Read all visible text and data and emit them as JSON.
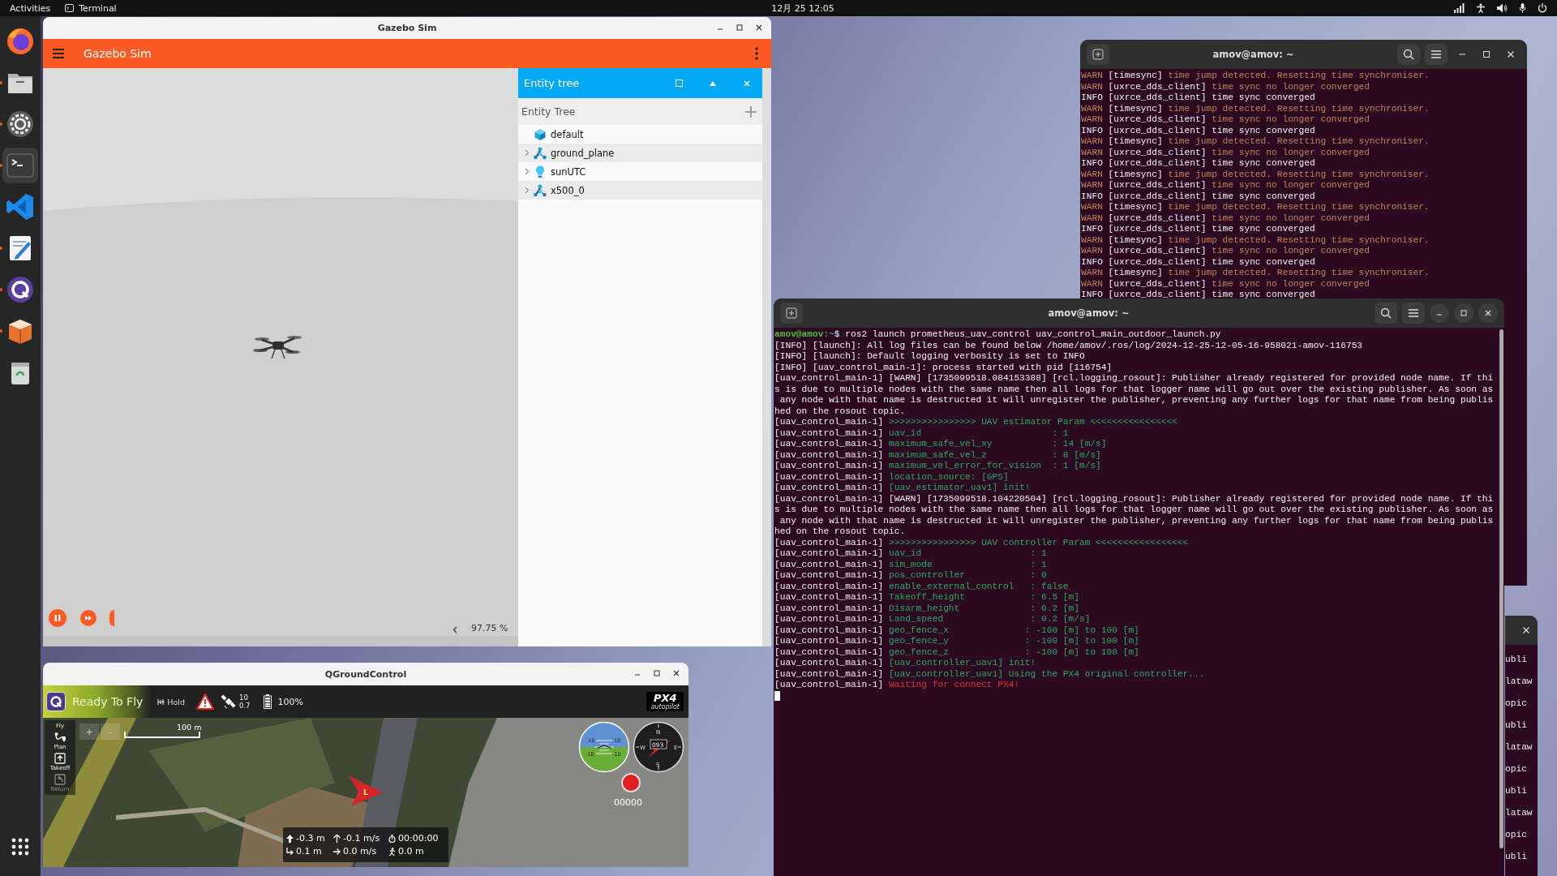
{
  "top_bar": {
    "activities": "Activities",
    "app_name": "Terminal",
    "clock": "12月 25 12:05"
  },
  "dock": {
    "apps": [
      {
        "kind": "firefox",
        "running": false,
        "selected": false
      },
      {
        "kind": "files",
        "running": true,
        "selected": false
      },
      {
        "kind": "settings",
        "running": true,
        "selected": false
      },
      {
        "kind": "terminal",
        "running": true,
        "selected": true
      },
      {
        "kind": "vscode",
        "running": false,
        "selected": false
      },
      {
        "kind": "editor",
        "running": true,
        "selected": false
      },
      {
        "kind": "qgc",
        "running": true,
        "selected": false
      },
      {
        "kind": "installer",
        "running": true,
        "selected": false
      },
      {
        "kind": "trash",
        "running": false,
        "selected": false
      }
    ]
  },
  "gazebo": {
    "title": "Gazebo Sim",
    "header": "Gazebo Sim",
    "paused": false,
    "rtf": "97.75 %",
    "panel": {
      "title": "Entity tree",
      "heading": "Entity Tree",
      "items": [
        {
          "label": "default",
          "kind": "world",
          "expandable": false
        },
        {
          "label": "ground_plane",
          "kind": "model",
          "expandable": true
        },
        {
          "label": "sunUTC",
          "kind": "light",
          "expandable": true
        },
        {
          "label": "x500_0",
          "kind": "model",
          "expandable": true
        }
      ]
    }
  },
  "terminal_back": {
    "title": "amov@amov: ~",
    "lines": [
      {
        "kind": "warn",
        "level": "WARN",
        "source": "[timesync]",
        "message": "time jump detected. Resetting time synchroniser."
      },
      {
        "kind": "warn",
        "level": "WARN",
        "source": "[uxrce_dds_client]",
        "message": "time sync no longer converged"
      },
      {
        "kind": "info",
        "level": "INFO",
        "source": "[uxrce_dds_client]",
        "message": "time sync converged"
      },
      {
        "kind": "warn",
        "level": "WARN",
        "source": "[timesync]",
        "message": "time jump detected. Resetting time synchroniser."
      },
      {
        "kind": "warn",
        "level": "WARN",
        "source": "[uxrce_dds_client]",
        "message": "time sync no longer converged"
      },
      {
        "kind": "info",
        "level": "INFO",
        "source": "[uxrce_dds_client]",
        "message": "time sync converged"
      },
      {
        "kind": "warn",
        "level": "WARN",
        "source": "[timesync]",
        "message": "time jump detected. Resetting time synchroniser."
      },
      {
        "kind": "warn",
        "level": "WARN",
        "source": "[uxrce_dds_client]",
        "message": "time sync no longer converged"
      },
      {
        "kind": "info",
        "level": "INFO",
        "source": "[uxrce_dds_client]",
        "message": "time sync converged"
      },
      {
        "kind": "warn",
        "level": "WARN",
        "source": "[timesync]",
        "message": "time jump detected. Resetting time synchroniser."
      },
      {
        "kind": "warn",
        "level": "WARN",
        "source": "[uxrce_dds_client]",
        "message": "time sync no longer converged"
      },
      {
        "kind": "info",
        "level": "INFO",
        "source": "[uxrce_dds_client]",
        "message": "time sync converged"
      },
      {
        "kind": "warn",
        "level": "WARN",
        "source": "[timesync]",
        "message": "time jump detected. Resetting time synchroniser."
      },
      {
        "kind": "warn",
        "level": "WARN",
        "source": "[uxrce_dds_client]",
        "message": "time sync no longer converged"
      },
      {
        "kind": "info",
        "level": "INFO",
        "source": "[uxrce_dds_client]",
        "message": "time sync converged"
      },
      {
        "kind": "warn",
        "level": "WARN",
        "source": "[timesync]",
        "message": "time jump detected. Resetting time synchroniser."
      },
      {
        "kind": "warn",
        "level": "WARN",
        "source": "[uxrce_dds_client]",
        "message": "time sync no longer converged"
      },
      {
        "kind": "info",
        "level": "INFO",
        "source": "[uxrce_dds_client]",
        "message": "time sync converged"
      },
      {
        "kind": "warn",
        "level": "WARN",
        "source": "[timesync]",
        "message": "time jump detected. Resetting time synchroniser."
      },
      {
        "kind": "warn",
        "level": "WARN",
        "source": "[uxrce_dds_client]",
        "message": "time sync no longer converged"
      },
      {
        "kind": "info",
        "level": "INFO",
        "source": "[uxrce_dds_client]",
        "message": "time sync converged"
      }
    ]
  },
  "terminal_front": {
    "title": "amov@amov: ~",
    "lines": [
      {
        "kind": "prompt",
        "user": "amov@amov:",
        "path": "~",
        "text": "$ ros2 launch prometheus_uav_control uav_control_main_outdoor_launch.py"
      },
      {
        "kind": "plain",
        "text": "[INFO] [launch]: All log files can be found below /home/amov/.ros/log/2024-12-25-12-05-16-958021-amov-116753"
      },
      {
        "kind": "plain",
        "text": "[INFO] [launch]: Default logging verbosity is set to INFO"
      },
      {
        "kind": "plain",
        "text": "[INFO] [uav_control_main-1]: process started with pid [116754]"
      },
      {
        "kind": "plain",
        "text": "[uav_control_main-1] [WARN] [1735099518.084153388] [rcl.logging_rosout]: Publisher already registered for provided node name. If thi"
      },
      {
        "kind": "plain",
        "text": "s is due to multiple nodes with the same name then all logs for that logger name will go out over the existing publisher. As soon as"
      },
      {
        "kind": "plain",
        "text": " any node with that name is destructed it will unregister the publisher, preventing any further logs for that name from being publis"
      },
      {
        "kind": "plain",
        "text": "hed on the rosout topic."
      },
      {
        "kind": "param",
        "prefix": "[uav_control_main-1]",
        "text": ">>>>>>>>>>>>>>>> UAV estimator Param <<<<<<<<<<<<<<<<"
      },
      {
        "kind": "param",
        "prefix": "[uav_control_main-1]",
        "text": "uav_id                        : 1"
      },
      {
        "kind": "param",
        "prefix": "[uav_control_main-1]",
        "text": "maximum_safe_vel_xy           : 14 [m/s]"
      },
      {
        "kind": "param",
        "prefix": "[uav_control_main-1]",
        "text": "maximum_safe_vel_z            : 8 [m/s]"
      },
      {
        "kind": "param",
        "prefix": "[uav_control_main-1]",
        "text": "maximum_vel_error_for_vision  : 1 [m/s]"
      },
      {
        "kind": "param",
        "prefix": "[uav_control_main-1]",
        "text": "location_source: [GPS]"
      },
      {
        "kind": "param",
        "prefix": "[uav_control_main-1]",
        "text": "[uav_estimator_uav1] init!"
      },
      {
        "kind": "plain",
        "text": "[uav_control_main-1] [WARN] [1735099518.104220504] [rcl.logging_rosout]: Publisher already registered for provided node name. If thi"
      },
      {
        "kind": "plain",
        "text": "s is due to multiple nodes with the same name then all logs for that logger name will go out over the existing publisher. As soon as"
      },
      {
        "kind": "plain",
        "text": " any node with that name is destructed it will unregister the publisher, preventing any further logs for that name from being publis"
      },
      {
        "kind": "plain",
        "text": "hed on the rosout topic."
      },
      {
        "kind": "param",
        "prefix": "[uav_control_main-1]",
        "text": ">>>>>>>>>>>>>>>> UAV controller Param <<<<<<<<<<<<<<<<<"
      },
      {
        "kind": "param",
        "prefix": "[uav_control_main-1]",
        "text": "uav_id                    : 1"
      },
      {
        "kind": "param",
        "prefix": "[uav_control_main-1]",
        "text": "sim_mode                  : 1"
      },
      {
        "kind": "param",
        "prefix": "[uav_control_main-1]",
        "text": "pos_controller            : 0"
      },
      {
        "kind": "param",
        "prefix": "[uav_control_main-1]",
        "text": "enable_external_control   : false"
      },
      {
        "kind": "param",
        "prefix": "[uav_control_main-1]",
        "text": "Takeoff_height            : 6.5 [m]"
      },
      {
        "kind": "param",
        "prefix": "[uav_control_main-1]",
        "text": "Disarm_height             : 0.2 [m]"
      },
      {
        "kind": "param",
        "prefix": "[uav_control_main-1]",
        "text": "Land_speed                : 0.2 [m/s]"
      },
      {
        "kind": "param",
        "prefix": "[uav_control_main-1]",
        "text": "geo_fence_x              : -100 [m] to 100 [m]"
      },
      {
        "kind": "param",
        "prefix": "[uav_control_main-1]",
        "text": "geo_fence_y              : -100 [m] to 100 [m]"
      },
      {
        "kind": "param",
        "prefix": "[uav_control_main-1]",
        "text": "geo_fence_z              : -100 [m] to 100 [m]"
      },
      {
        "kind": "param",
        "prefix": "[uav_control_main-1]",
        "text": "[uav_controller_uav1] init!"
      },
      {
        "kind": "param",
        "prefix": "[uav_control_main-1]",
        "text": "[uav_controller_uav1] Using the PX4 original controller..."
      },
      {
        "kind": "error",
        "prefix": "[uav_control_main-1]",
        "text": "Waiting for connect PX4!"
      }
    ]
  },
  "side_terminal": {
    "lines": [
      "ubli",
      "lataw",
      "opic",
      "ubli",
      "lataw",
      "opic",
      "ubli",
      "lataw",
      "opic",
      "ubli"
    ]
  },
  "qgc": {
    "title": "QGroundControl",
    "status": "Ready To Fly",
    "flight_mode": "Hold",
    "satellite_count": "10",
    "hdop": "0.7",
    "battery": "100%",
    "brand": "PX4",
    "brand_sub": "autopilot",
    "tools": [
      {
        "kind": "fly",
        "label": "Fly",
        "disabled": false
      },
      {
        "kind": "plan",
        "label": "Plan",
        "disabled": false
      },
      {
        "kind": "takeoff",
        "label": "Takeoff",
        "disabled": false
      },
      {
        "kind": "return",
        "label": "Return",
        "disabled": true
      }
    ],
    "zoom_in": "+",
    "zoom_out": "-",
    "scale": "100 m",
    "attitude_ticks": [
      "10",
      "10",
      "-10",
      "-10"
    ],
    "compass": {
      "north": "N",
      "west": "W",
      "east": "E",
      "south": "S",
      "heading": "093"
    },
    "vehicle_label": "L",
    "recording_counter": "00000",
    "telemetry": [
      {
        "kind": "altitude",
        "value": "-0.3 m"
      },
      {
        "kind": "climb",
        "value": "-0.1 m/s"
      },
      {
        "kind": "time",
        "value": "00:00:00"
      },
      {
        "kind": "distance",
        "value": "0.1 m"
      },
      {
        "kind": "speed",
        "value": "0.0 m/s"
      },
      {
        "kind": "odometer",
        "value": "0.0 m"
      }
    ]
  }
}
